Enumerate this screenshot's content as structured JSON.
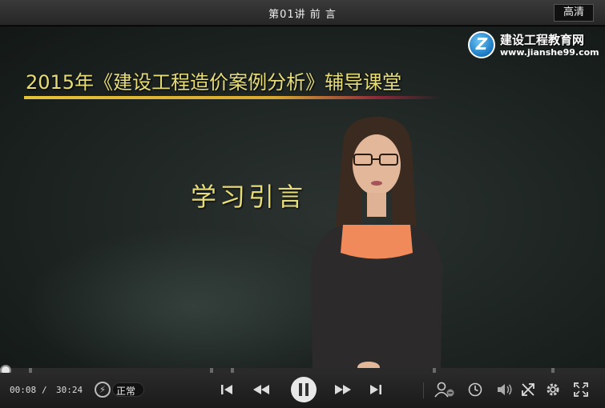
{
  "titlebar": {
    "title": "第01讲  前  言",
    "quality_label": "高清"
  },
  "video": {
    "course_title": "2015年《建设工程造价案例分析》辅导课堂",
    "section_title": "学习引言",
    "logo": {
      "name": "建设工程教育网",
      "url": "www.jianshe99.com",
      "mark": "Z"
    }
  },
  "player": {
    "current_time": "00:08",
    "separator": "/",
    "total_time": "30:24",
    "progress_fraction": 0.0044,
    "speed_label": "正常"
  },
  "colors": {
    "title_text": "#e6dc7a",
    "logo_blue": "#1a78c2"
  },
  "icons": {
    "prev": "skip-previous-icon",
    "rewind": "rewind-icon",
    "pause": "pause-icon",
    "forward": "fast-forward-icon",
    "next": "skip-next-icon",
    "user": "user-icon",
    "clock": "clock-icon",
    "volume": "volume-icon",
    "pip": "shrink-icon",
    "settings": "gear-icon",
    "fullscreen": "fullscreen-icon"
  }
}
